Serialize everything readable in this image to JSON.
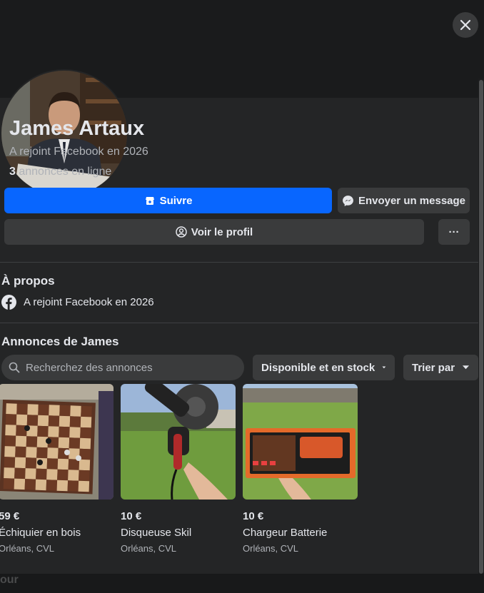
{
  "close": {
    "icon": "close-icon"
  },
  "profile": {
    "name": "James Artaux",
    "joined": "A rejoint Facebook en 2026",
    "listings_count": "3",
    "listings_suffix": " annonces en ligne"
  },
  "actions": {
    "follow": "Suivre",
    "message": "Envoyer un message",
    "view_profile": "Voir le profil",
    "more": "···"
  },
  "about": {
    "heading": "À propos",
    "joined": "A rejoint Facebook en 2026"
  },
  "listings_section": {
    "heading": "Annonces de James",
    "search_placeholder": "Recherchez des annonces",
    "filter": "Disponible et en stock",
    "sort": "Trier par"
  },
  "items": [
    {
      "price": "59 €",
      "title": "Échiquier en bois",
      "location": "Orléans, CVL"
    },
    {
      "price": "10 €",
      "title": "Disqueuse Skil",
      "location": "Orléans, CVL"
    },
    {
      "price": "10 €",
      "title": "Chargeur Batterie",
      "location": "Orléans, CVL"
    }
  ],
  "bottom_peek": "our",
  "colors": {
    "accent": "#0866ff",
    "panel": "#242526",
    "button": "#3a3b3c"
  }
}
